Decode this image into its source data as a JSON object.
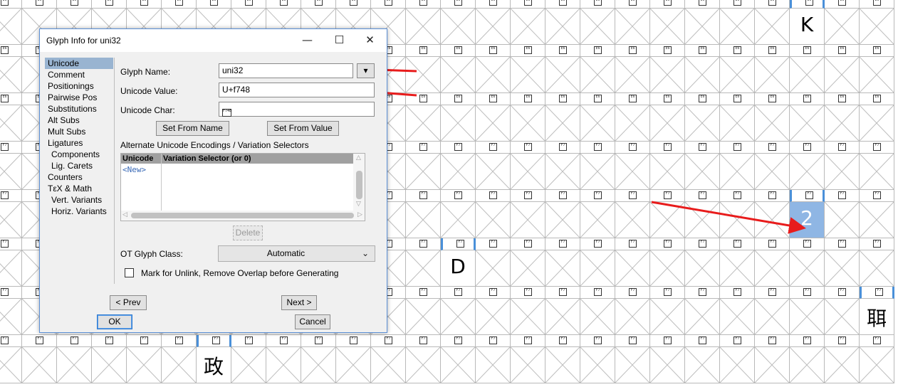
{
  "dialog": {
    "title": "Glyph Info for uni32",
    "window_controls": {
      "minimize": "—",
      "maximize": "☐",
      "close": "✕"
    },
    "sidebar": [
      {
        "label": "Unicode",
        "active": true,
        "sub": false
      },
      {
        "label": "Comment",
        "active": false,
        "sub": false
      },
      {
        "label": "Positionings",
        "active": false,
        "sub": false
      },
      {
        "label": "Pairwise Pos",
        "active": false,
        "sub": false
      },
      {
        "label": "Substitutions",
        "active": false,
        "sub": false
      },
      {
        "label": "Alt Subs",
        "active": false,
        "sub": false
      },
      {
        "label": "Mult Subs",
        "active": false,
        "sub": false
      },
      {
        "label": "Ligatures",
        "active": false,
        "sub": false
      },
      {
        "label": "Components",
        "active": false,
        "sub": true
      },
      {
        "label": "Lig. Carets",
        "active": false,
        "sub": true
      },
      {
        "label": "Counters",
        "active": false,
        "sub": false
      },
      {
        "label": "TεX & Math",
        "active": false,
        "sub": false
      },
      {
        "label": "Vert. Variants",
        "active": false,
        "sub": true
      },
      {
        "label": "Horiz. Variants",
        "active": false,
        "sub": true
      }
    ],
    "glyph_name_label": "Glyph Name:",
    "glyph_name_value": "uni32",
    "glyph_name_dropdown": "▾",
    "unicode_value_label": "Unicode Value:",
    "unicode_value_value": "U+f748",
    "unicode_char_label": "Unicode Char:",
    "unicode_char_value": "F748",
    "set_from_name": "Set From Name",
    "set_from_value": "Set From Value",
    "alt_encodings_label": "Alternate Unicode Encodings / Variation Selectors",
    "table_headers": [
      "Unicode",
      "Variation Selector (or 0)"
    ],
    "table_new_row": "<New>",
    "delete_button": "Delete",
    "ot_class_label": "OT Glyph Class:",
    "ot_class_value": "Automatic",
    "mark_unlink_label": "Mark for Unlink, Remove Overlap before Generating",
    "mark_unlink_checked": false,
    "prev_button": "< Prev",
    "next_button": "Next >",
    "ok_button": "OK",
    "cancel_button": "Cancel"
  },
  "font_view": {
    "accent_color": "#4a90d9",
    "selected_color": "#8fb6e4",
    "header_rows": [
      [
        "E6",
        "E6",
        "E6",
        "E6",
        "E6",
        "E6",
        "E6",
        "E6",
        "E6",
        "E6",
        "E6",
        "E6",
        "E6",
        "E6",
        "E6",
        "E6",
        "E6",
        "E6",
        "E6",
        "E6",
        "E6",
        "E6",
        "E6",
        "E6",
        "E6",
        "E6"
      ],
      [
        "E6",
        "E6",
        "E6",
        "E6",
        "E6",
        "E6",
        "E6",
        "E6",
        "E6",
        "E6",
        "E6",
        "E6",
        "E6",
        "E6",
        "E6",
        "E6",
        "E6",
        "E6",
        "E6",
        "E6",
        "E6",
        "E6",
        "E6",
        "E6",
        "E6",
        "E6"
      ],
      [
        "E6",
        "E6",
        "E6",
        "E6",
        "E6",
        "E6",
        "E6",
        "E6",
        "E6",
        "E6",
        "E6",
        "E6",
        "E6",
        "E6",
        "E6",
        "E6",
        "E6",
        "E6",
        "E6",
        "E6",
        "E6",
        "E6",
        "E6",
        "E6",
        "E6",
        "E6"
      ],
      [
        "F7",
        "F7",
        "F7",
        "F7",
        "F7",
        "F7",
        "F7",
        "F7",
        "F7",
        "F7",
        "F7",
        "F7",
        "F7",
        "F7",
        "F7",
        "F7",
        "F7",
        "F7",
        "F7",
        "F7",
        "F7",
        "F7",
        "F7",
        "F7",
        "F7",
        "F7"
      ],
      [
        "F7",
        "F7",
        "F7",
        "F7",
        "F7",
        "F7",
        "F7",
        "F7",
        "F7",
        "F7",
        "F7",
        "F7",
        "F7",
        "F7",
        "F7",
        "F7",
        "F7",
        "F7",
        "F7",
        "F7",
        "F7",
        "F7",
        "F7",
        "F7",
        "F7",
        "F7"
      ],
      [
        "F7",
        "F7",
        "F7",
        "F7",
        "F7",
        "F7",
        "F7",
        "F7",
        "F7",
        "F7",
        "F7",
        "F7",
        "F7",
        "F7",
        "F7",
        "F7",
        "F7",
        "F7",
        "F7",
        "F7",
        "F7",
        "F7",
        "F7",
        "F7",
        "F7",
        "F7"
      ],
      [
        "F7",
        "F7",
        "F7",
        "F7",
        "F7",
        "F7",
        "F7",
        "F7",
        "F7",
        "F7",
        "F7",
        "F7",
        "F7",
        "F7",
        "F7",
        "F7",
        "F7",
        "F7",
        "F7",
        "F7",
        "F7",
        "F7",
        "F7",
        "F7",
        "F7",
        "F7"
      ],
      [
        "F7",
        "F7",
        "F7",
        "F7",
        "F7",
        "F7",
        "F7",
        "F7",
        "F7",
        "F7",
        "F7",
        "F7",
        "F7",
        "F7",
        "F7",
        "F7",
        "F7",
        "F7",
        "F7",
        "F7",
        "F7",
        "F7",
        "F7",
        "F7",
        "F7",
        "F7"
      ]
    ],
    "glyphs": [
      {
        "row": 0,
        "col": 23,
        "char": "K",
        "selected": false
      },
      {
        "row": 4,
        "col": 23,
        "char": "2",
        "selected": true
      },
      {
        "row": 5,
        "col": 13,
        "char": "D",
        "selected": false
      },
      {
        "row": 6,
        "col": 25,
        "char": "聑",
        "selected": false
      },
      {
        "row": 7,
        "col": 6,
        "char": "政",
        "selected": false
      }
    ],
    "marked_headers": [
      {
        "row": 0,
        "col": 23
      },
      {
        "row": 4,
        "col": 23
      },
      {
        "row": 5,
        "col": 13
      },
      {
        "row": 6,
        "col": 25
      },
      {
        "row": 7,
        "col": 6
      }
    ]
  }
}
